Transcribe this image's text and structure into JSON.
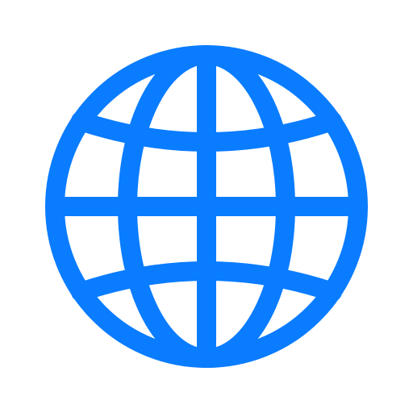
{
  "icon": {
    "name": "globe-icon",
    "color": "#0a7cff",
    "background": "#ffffff"
  }
}
